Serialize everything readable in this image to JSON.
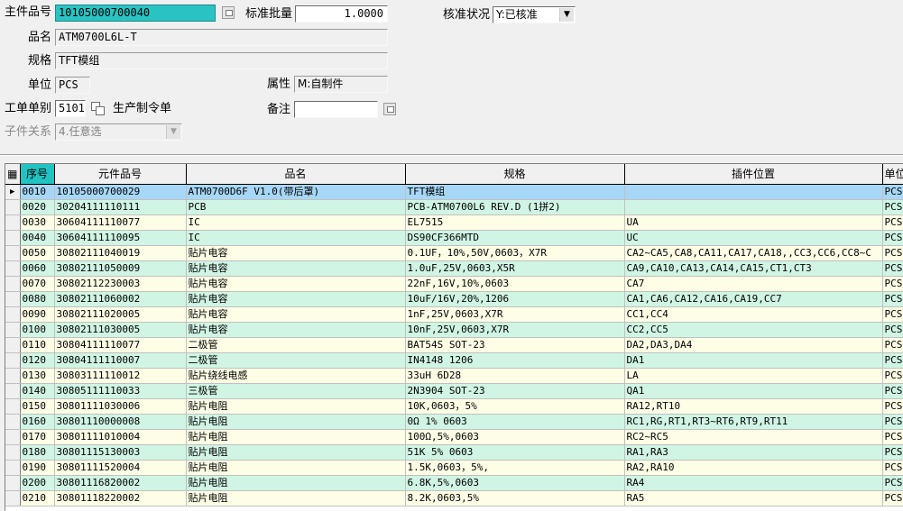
{
  "form": {
    "main_part_label": "主件品号",
    "main_part_value": "10105000700040",
    "std_qty_label": "标准批量",
    "std_qty_value": "1.0000",
    "approval_label": "核准状况",
    "approval_value": "Y:已核准",
    "name_label": "品名",
    "name_value": "ATM0700L6L-T",
    "spec_label": "规格",
    "spec_value": "TFT模组",
    "unit_label": "单位",
    "unit_value": "PCS",
    "attr_label": "属性",
    "attr_value": "M:自制件",
    "wo_type_label": "工单单别",
    "wo_type_value": "5101",
    "wo_type_desc": "生产制令单",
    "remark_label": "备注",
    "remark_value": "",
    "child_rel_label": "子件关系",
    "child_rel_value": "4.任意选"
  },
  "grid": {
    "columns": [
      "序号",
      "元件品号",
      "品名",
      "规格",
      "插件位置",
      "单位"
    ],
    "rows": [
      {
        "seq": "0010",
        "part": "10105000700029",
        "name": "ATM0700D6F V1.0(带后罩)",
        "spec": "TFT模组",
        "pos": "",
        "unit": "PCS"
      },
      {
        "seq": "0020",
        "part": "30204111110111",
        "name": "PCB",
        "spec": "PCB-ATM0700L6 REV.D (1拼2)",
        "pos": "",
        "unit": "PCS"
      },
      {
        "seq": "0030",
        "part": "30604111110077",
        "name": "IC",
        "spec": "EL7515",
        "pos": "UA",
        "unit": "PCS"
      },
      {
        "seq": "0040",
        "part": "30604111110095",
        "name": "IC",
        "spec": "DS90CF366MTD",
        "pos": "UC",
        "unit": "PCS"
      },
      {
        "seq": "0050",
        "part": "30802111040019",
        "name": "贴片电容",
        "spec": "0.1UF，10%,50V,0603，X7R",
        "pos": "CA2~CA5,CA8,CA11,CA17,CA18,,CC3,CC6,CC8~C",
        "unit": "PCS"
      },
      {
        "seq": "0060",
        "part": "30802111050009",
        "name": "贴片电容",
        "spec": "1.0uF,25V,0603,X5R",
        "pos": "CA9,CA10,CA13,CA14,CA15,CT1,CT3",
        "unit": "PCS"
      },
      {
        "seq": "0070",
        "part": "30802112230003",
        "name": "贴片电容",
        "spec": "22nF,16V,10%,0603",
        "pos": "CA7",
        "unit": "PCS"
      },
      {
        "seq": "0080",
        "part": "30802111060002",
        "name": "贴片电容",
        "spec": "10uF/16V,20%,1206",
        "pos": "CA1,CA6,CA12,CA16,CA19,CC7",
        "unit": "PCS"
      },
      {
        "seq": "0090",
        "part": "30802111020005",
        "name": "贴片电容",
        "spec": "1nF,25V,0603,X7R",
        "pos": "CC1,CC4",
        "unit": "PCS"
      },
      {
        "seq": "0100",
        "part": "30802111030005",
        "name": "贴片电容",
        "spec": "10nF,25V,0603,X7R",
        "pos": "CC2,CC5",
        "unit": "PCS"
      },
      {
        "seq": "0110",
        "part": "30804111110077",
        "name": "二极管",
        "spec": "BAT54S SOT-23",
        "pos": "DA2,DA3,DA4",
        "unit": "PCS"
      },
      {
        "seq": "0120",
        "part": "30804111110007",
        "name": "二极管",
        "spec": "IN4148  1206",
        "pos": "DA1",
        "unit": "PCS"
      },
      {
        "seq": "0130",
        "part": "30803111110012",
        "name": "贴片绕线电感",
        "spec": "33uH 6D28",
        "pos": "LA",
        "unit": "PCS"
      },
      {
        "seq": "0140",
        "part": "30805111110033",
        "name": "三极管",
        "spec": "2N3904 SOT-23",
        "pos": "QA1",
        "unit": "PCS"
      },
      {
        "seq": "0150",
        "part": "30801111030006",
        "name": "贴片电阻",
        "spec": "10K,0603，5%",
        "pos": "RA12,RT10",
        "unit": "PCS"
      },
      {
        "seq": "0160",
        "part": "30801110000008",
        "name": "贴片电阻",
        "spec": "0Ω  1% 0603",
        "pos": "RC1,RG,RT1,RT3~RT6,RT9,RT11",
        "unit": "PCS"
      },
      {
        "seq": "0170",
        "part": "30801111010004",
        "name": "贴片电阻",
        "spec": "100Ω,5%,0603",
        "pos": "RC2~RC5",
        "unit": "PCS"
      },
      {
        "seq": "0180",
        "part": "30801115130003",
        "name": "贴片电阻",
        "spec": "51K 5% 0603",
        "pos": "RA1,RA3",
        "unit": "PCS"
      },
      {
        "seq": "0190",
        "part": "30801111520004",
        "name": "贴片电阻",
        "spec": "1.5K,0603，5%,",
        "pos": "RA2,RA10",
        "unit": "PCS"
      },
      {
        "seq": "0200",
        "part": "30801116820002",
        "name": "贴片电阻",
        "spec": "6.8K,5%,0603",
        "pos": "RA4",
        "unit": "PCS"
      },
      {
        "seq": "0210",
        "part": "30801118220002",
        "name": "贴片电阻",
        "spec": "8.2K,0603,5%",
        "pos": "RA5",
        "unit": "PCS"
      }
    ]
  }
}
